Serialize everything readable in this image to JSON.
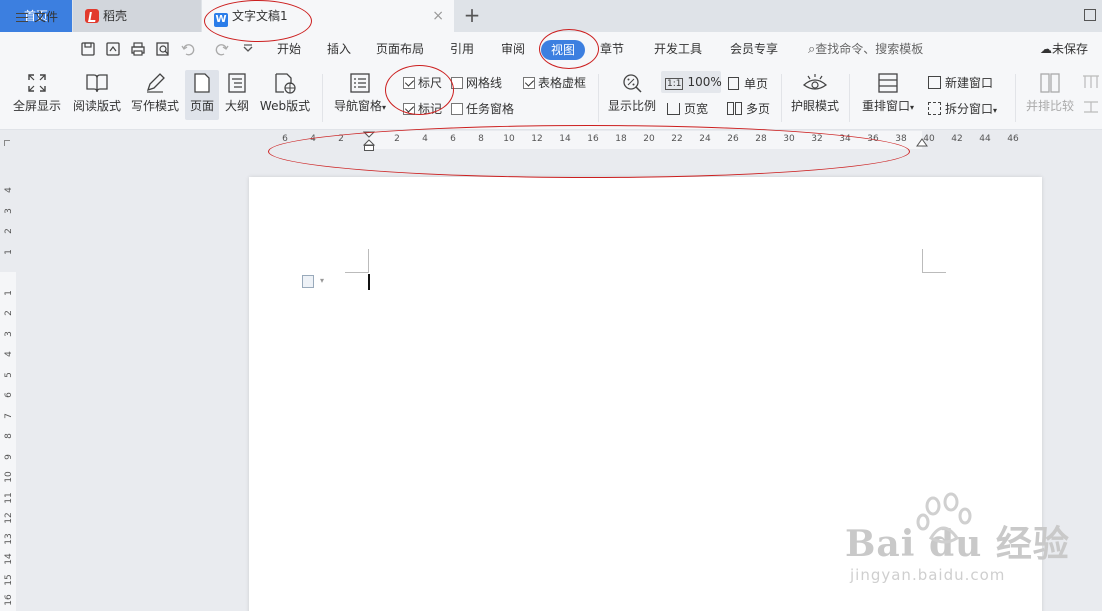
{
  "tabs": {
    "home": "首页",
    "daoke": "稻壳",
    "document": "文字文稿1",
    "close_glyph": "×",
    "add_glyph": "+"
  },
  "menu": {
    "file": "文件",
    "items": [
      "开始",
      "插入",
      "页面布局",
      "引用",
      "审阅",
      "视图",
      "章节",
      "开发工具",
      "会员专享"
    ],
    "active": "视图",
    "search": "查找命令、搜索模板",
    "save_status": "未保存"
  },
  "ribbon": {
    "fullscreen": "全屏显示",
    "reading": "阅读版式",
    "writing": "写作模式",
    "page": "页面",
    "outline": "大纲",
    "web": "Web版式",
    "nav_pane": "导航窗格",
    "ruler": "标尺",
    "gridlines": "网格线",
    "table_gridlines": "表格虚框",
    "marks": "标记",
    "task_pane": "任务窗格",
    "zoom": "显示比例",
    "zoom_value": "100%",
    "zoom_box": "1:1",
    "single_page": "单页",
    "page_width": "页宽",
    "multi_page": "多页",
    "eye_mode": "护眼模式",
    "arrange": "重排窗口",
    "new_window": "新建窗口",
    "split_window": "拆分窗口",
    "side_by_side": "并排比较",
    "checks": {
      "ruler": true,
      "gridlines": false,
      "table_gridlines": true,
      "marks": true,
      "task_pane": false
    }
  },
  "ruler": {
    "h_left": [
      "6",
      "4",
      "2"
    ],
    "h_right": [
      "2",
      "4",
      "6",
      "8",
      "10",
      "12",
      "14",
      "16",
      "18",
      "20",
      "22",
      "24",
      "26",
      "28",
      "30",
      "32",
      "34",
      "36",
      "38",
      "40",
      "42",
      "44",
      "46"
    ],
    "v_top": [
      "4",
      "3",
      "2",
      "1"
    ],
    "v_bottom": [
      "1",
      "2",
      "3",
      "4",
      "5",
      "6",
      "7",
      "8",
      "9",
      "10",
      "11",
      "12",
      "13",
      "14",
      "15",
      "16"
    ]
  },
  "watermark": {
    "logo": "Bai du 经验",
    "url": "jingyan.baidu.com"
  },
  "colors": {
    "accent": "#3c7fe0",
    "annotation": "#cc1f1f"
  }
}
